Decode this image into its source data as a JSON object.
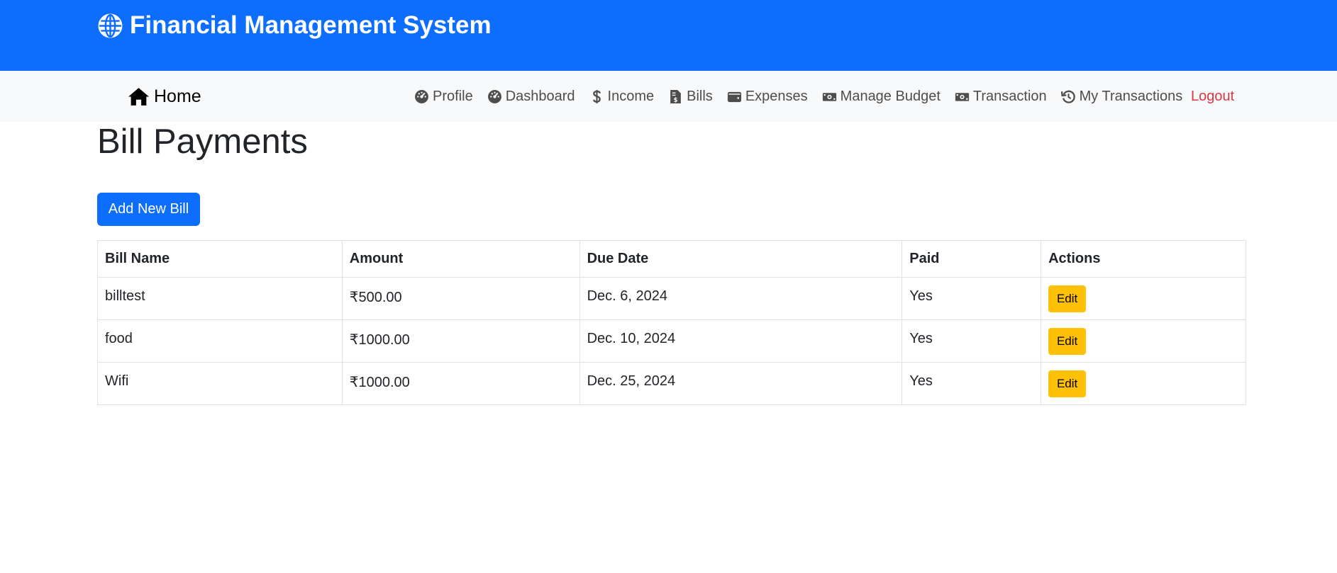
{
  "header": {
    "icon": "globe-icon",
    "title": "Financial Management System",
    "background": "#0d6efd"
  },
  "navbar": {
    "home": {
      "icon": "home-icon",
      "label": "Home"
    },
    "items": [
      {
        "icon": "gauge-icon",
        "label": "Profile"
      },
      {
        "icon": "gauge-icon",
        "label": "Dashboard"
      },
      {
        "icon": "dollar-icon",
        "label": "Income"
      },
      {
        "icon": "bill-file-icon",
        "label": "Bills"
      },
      {
        "icon": "wallet-icon",
        "label": "Expenses"
      },
      {
        "icon": "money-bill-icon",
        "label": "Manage Budget"
      },
      {
        "icon": "money-bill-icon",
        "label": "Transaction"
      },
      {
        "icon": "history-icon",
        "label": "My Transactions"
      }
    ],
    "logout": {
      "label": "Logout",
      "color": "#dc3545"
    }
  },
  "page": {
    "title": "Bill Payments",
    "add_button_label": "Add New Bill"
  },
  "table": {
    "headers": [
      "Bill Name",
      "Amount",
      "Due Date",
      "Paid",
      "Actions"
    ],
    "rows": [
      {
        "name": "billtest",
        "amount": "₹500.00",
        "due_date": "Dec. 6, 2024",
        "paid": "Yes",
        "action_label": "Edit"
      },
      {
        "name": "food",
        "amount": "₹1000.00",
        "due_date": "Dec. 10, 2024",
        "paid": "Yes",
        "action_label": "Edit"
      },
      {
        "name": "Wifi",
        "amount": "₹1000.00",
        "due_date": "Dec. 25, 2024",
        "paid": "Yes",
        "action_label": "Edit"
      }
    ]
  },
  "colors": {
    "primary": "#0d6efd",
    "warning": "#ffc107",
    "danger": "#dc3545",
    "navbar_bg": "#f8f9fa"
  }
}
